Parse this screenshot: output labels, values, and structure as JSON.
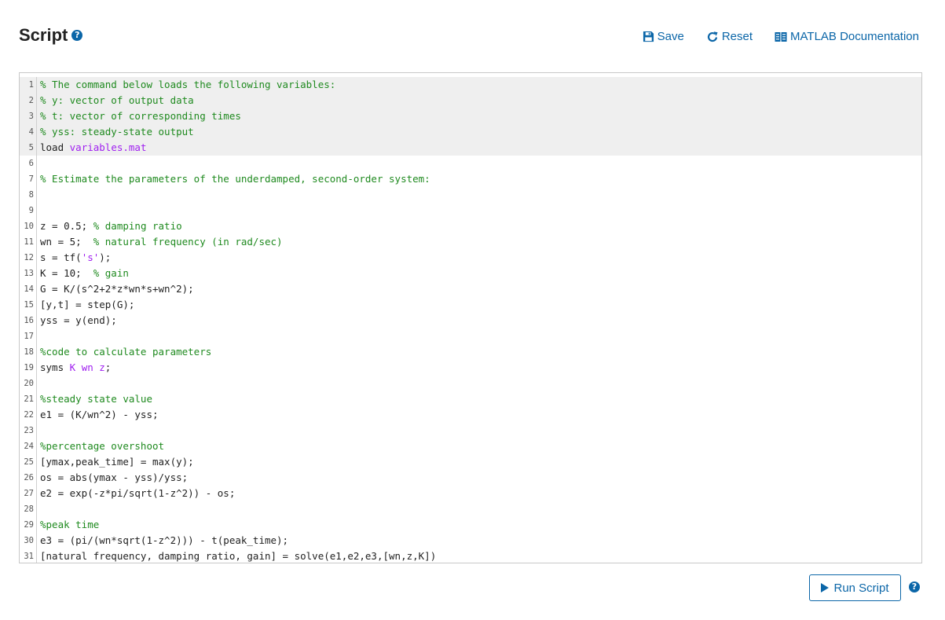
{
  "header": {
    "title": "Script",
    "save_label": "Save",
    "reset_label": "Reset",
    "docs_label": "MATLAB Documentation"
  },
  "colors": {
    "accent": "#0b66a8",
    "comment": "#1f8a1f",
    "string": "#a020f0",
    "locked_background": "#efefef"
  },
  "editor": {
    "lines": [
      {
        "n": "1",
        "locked": true,
        "tokens": [
          {
            "t": "% The command below loads the following variables:",
            "c": "com"
          }
        ]
      },
      {
        "n": "2",
        "locked": true,
        "tokens": [
          {
            "t": "% y: vector of output data",
            "c": "com"
          }
        ]
      },
      {
        "n": "3",
        "locked": true,
        "tokens": [
          {
            "t": "% t: vector of corresponding times",
            "c": "com"
          }
        ]
      },
      {
        "n": "4",
        "locked": true,
        "tokens": [
          {
            "t": "% yss: steady-state output",
            "c": "com"
          }
        ]
      },
      {
        "n": "5",
        "locked": true,
        "tokens": [
          {
            "t": "load ",
            "c": ""
          },
          {
            "t": "variables.mat",
            "c": "str"
          }
        ]
      },
      {
        "n": "6",
        "locked": false,
        "tokens": []
      },
      {
        "n": "7",
        "locked": false,
        "tokens": [
          {
            "t": "% Estimate the parameters of the underdamped, second-order system:",
            "c": "com"
          }
        ]
      },
      {
        "n": "8",
        "locked": false,
        "tokens": []
      },
      {
        "n": "9",
        "locked": false,
        "tokens": []
      },
      {
        "n": "10",
        "locked": false,
        "tokens": [
          {
            "t": "z = 0.5; ",
            "c": ""
          },
          {
            "t": "% damping ratio",
            "c": "com"
          }
        ]
      },
      {
        "n": "11",
        "locked": false,
        "tokens": [
          {
            "t": "wn = 5;  ",
            "c": ""
          },
          {
            "t": "% natural frequency (in rad/sec)",
            "c": "com"
          }
        ]
      },
      {
        "n": "12",
        "locked": false,
        "tokens": [
          {
            "t": "s = tf(",
            "c": ""
          },
          {
            "t": "'s'",
            "c": "str"
          },
          {
            "t": ");",
            "c": ""
          }
        ]
      },
      {
        "n": "13",
        "locked": false,
        "tokens": [
          {
            "t": "K = 10;  ",
            "c": ""
          },
          {
            "t": "% gain",
            "c": "com"
          }
        ]
      },
      {
        "n": "14",
        "locked": false,
        "tokens": [
          {
            "t": "G = K/(s^2+2*z*wn*s+wn^2);",
            "c": ""
          }
        ]
      },
      {
        "n": "15",
        "locked": false,
        "tokens": [
          {
            "t": "[y,t] = step(G);",
            "c": ""
          }
        ]
      },
      {
        "n": "16",
        "locked": false,
        "tokens": [
          {
            "t": "yss = y(end);",
            "c": ""
          }
        ]
      },
      {
        "n": "17",
        "locked": false,
        "tokens": []
      },
      {
        "n": "18",
        "locked": false,
        "tokens": [
          {
            "t": "%code to calculate parameters",
            "c": "com"
          }
        ]
      },
      {
        "n": "19",
        "locked": false,
        "tokens": [
          {
            "t": "syms ",
            "c": ""
          },
          {
            "t": "K wn z",
            "c": "str"
          },
          {
            "t": ";",
            "c": ""
          }
        ]
      },
      {
        "n": "20",
        "locked": false,
        "tokens": []
      },
      {
        "n": "21",
        "locked": false,
        "tokens": [
          {
            "t": "%steady state value",
            "c": "com"
          }
        ]
      },
      {
        "n": "22",
        "locked": false,
        "tokens": [
          {
            "t": "e1 = (K/wn^2) - yss;",
            "c": ""
          }
        ]
      },
      {
        "n": "23",
        "locked": false,
        "tokens": []
      },
      {
        "n": "24",
        "locked": false,
        "tokens": [
          {
            "t": "%percentage overshoot",
            "c": "com"
          }
        ]
      },
      {
        "n": "25",
        "locked": false,
        "tokens": [
          {
            "t": "[ymax,peak_time] = max(y);",
            "c": ""
          }
        ]
      },
      {
        "n": "26",
        "locked": false,
        "tokens": [
          {
            "t": "os = abs(ymax - yss)/yss;",
            "c": ""
          }
        ]
      },
      {
        "n": "27",
        "locked": false,
        "tokens": [
          {
            "t": "e2 = exp(-z*pi/sqrt(1-z^2)) - os;",
            "c": ""
          }
        ]
      },
      {
        "n": "28",
        "locked": false,
        "tokens": []
      },
      {
        "n": "29",
        "locked": false,
        "tokens": [
          {
            "t": "%peak time",
            "c": "com"
          }
        ]
      },
      {
        "n": "30",
        "locked": false,
        "tokens": [
          {
            "t": "e3 = (pi/(wn*sqrt(1-z^2))) - t(peak_time);",
            "c": ""
          }
        ]
      },
      {
        "n": "31",
        "locked": false,
        "tokens": [
          {
            "t": "[natural frequency, damping ratio, gain] = solve(e1,e2,e3,[wn,z,K])",
            "c": ""
          }
        ]
      }
    ]
  },
  "footer": {
    "run_label": "Run Script"
  }
}
